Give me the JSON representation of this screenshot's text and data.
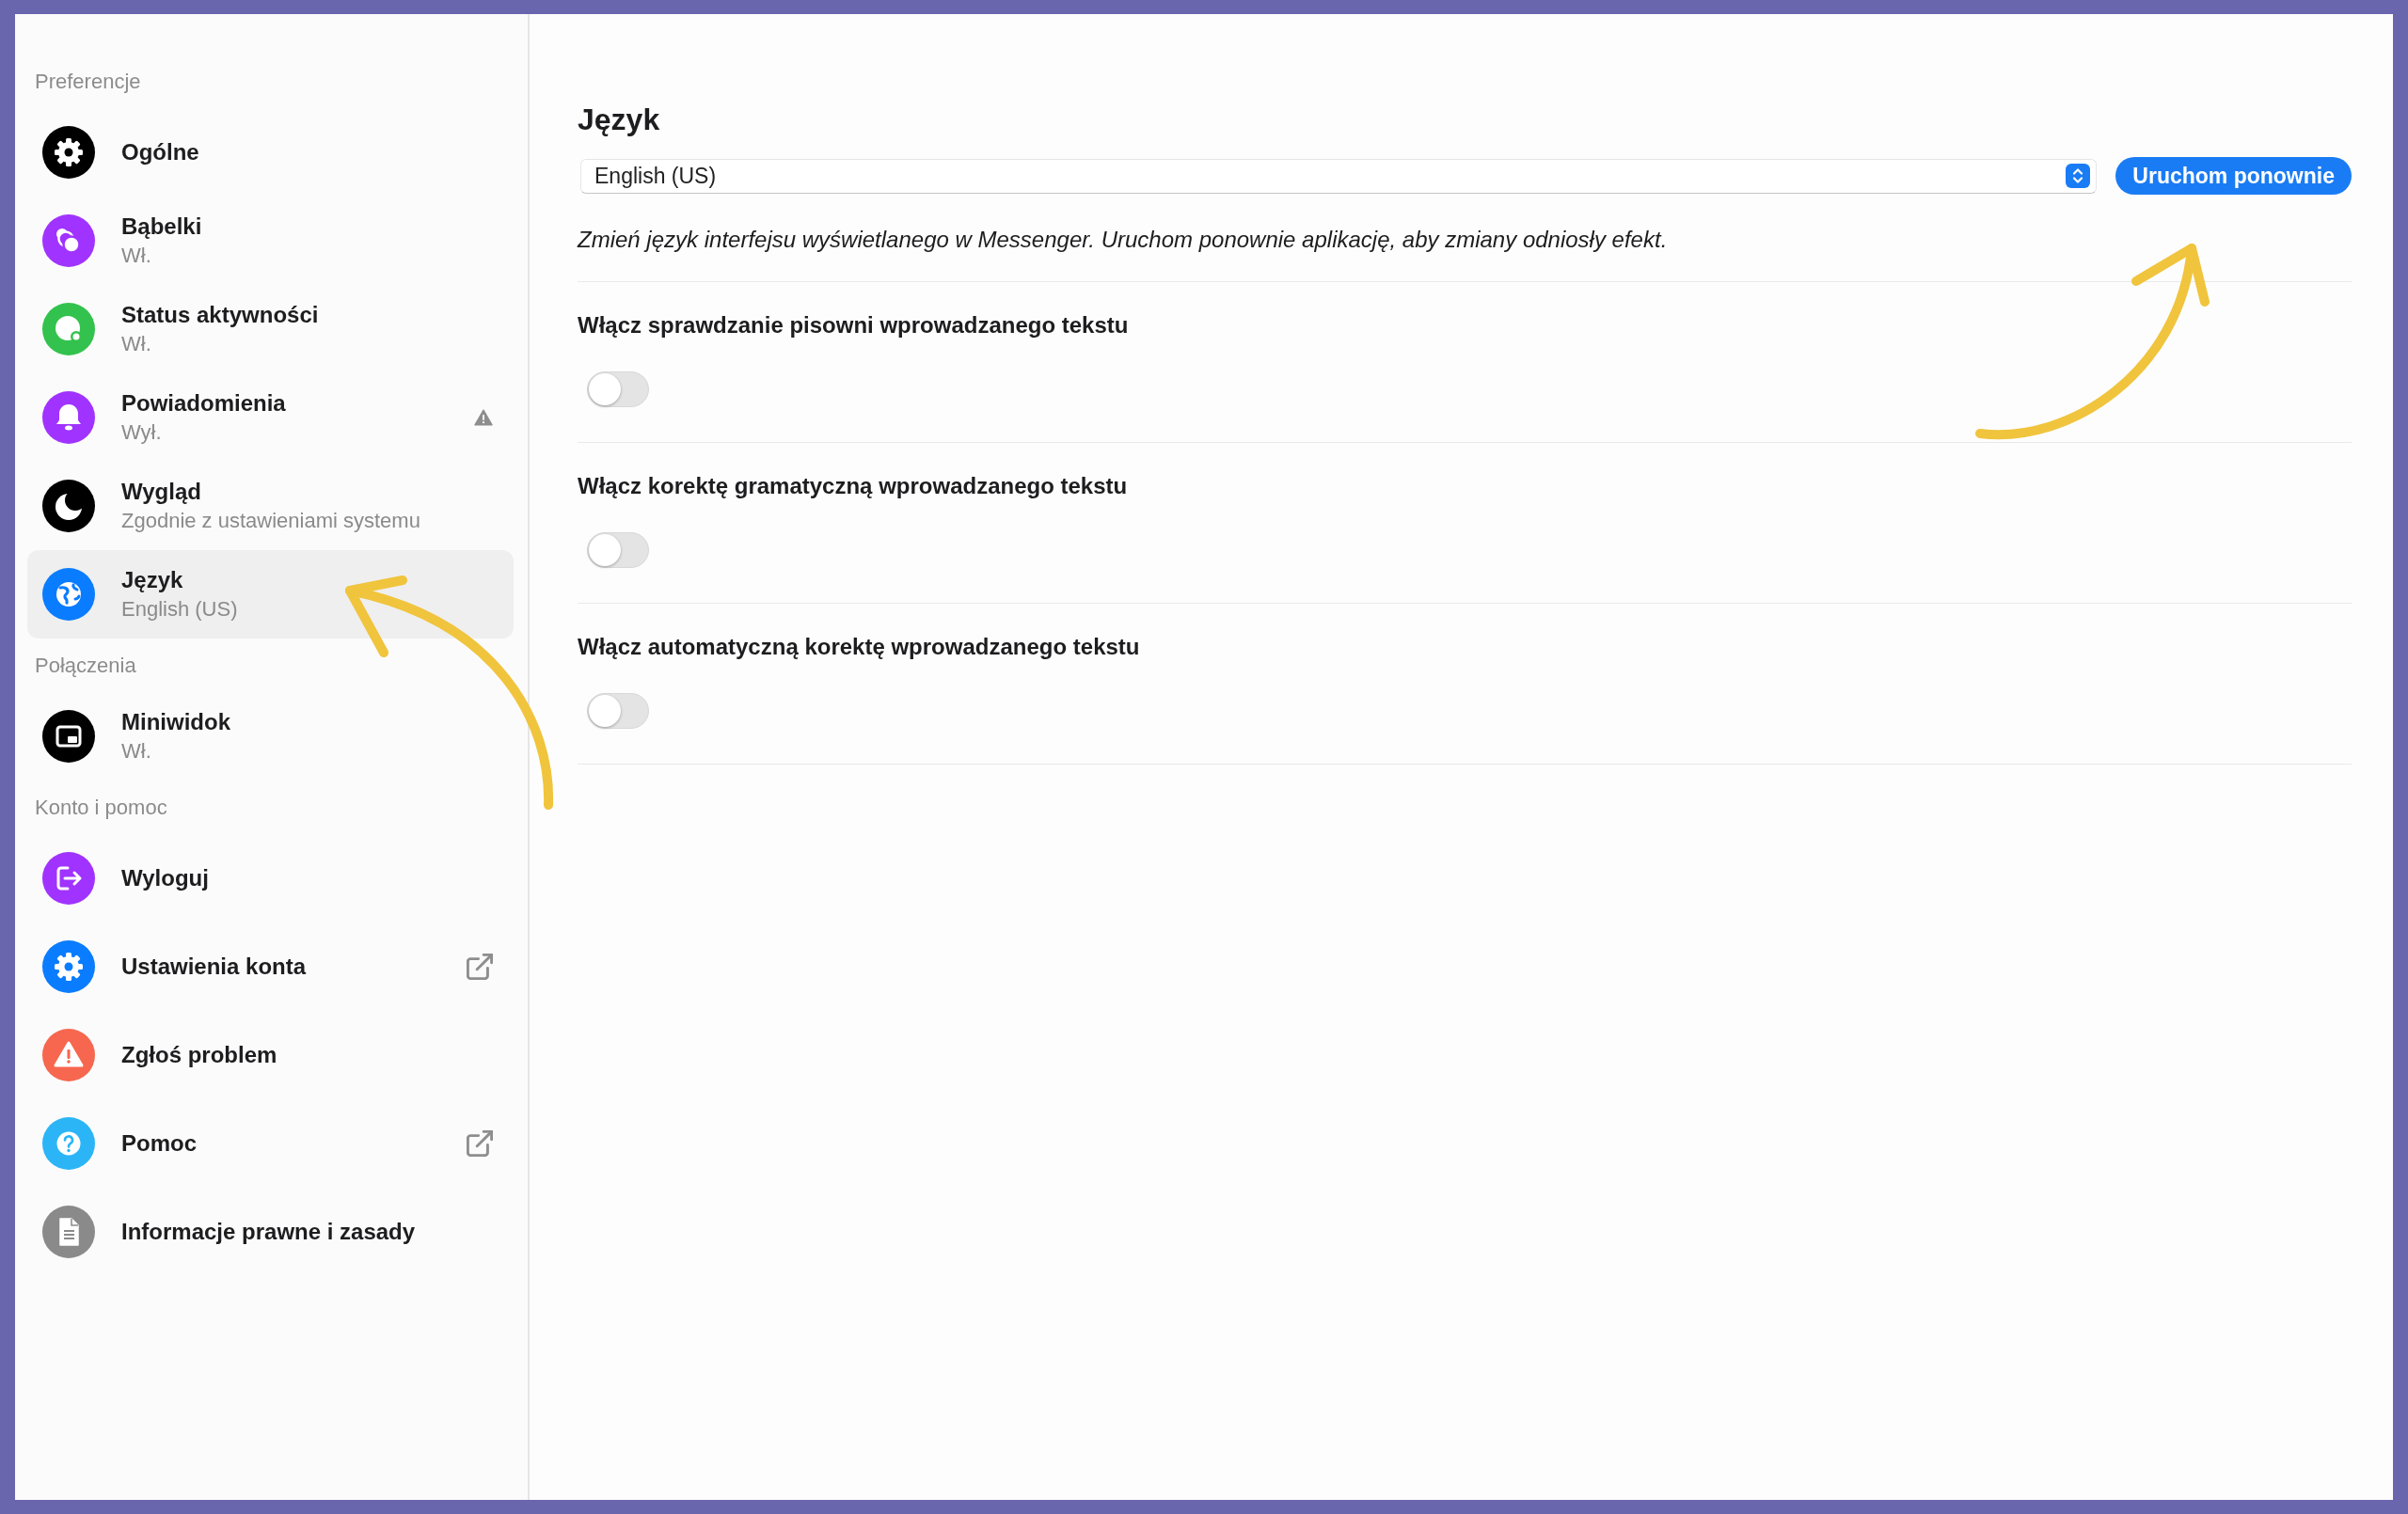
{
  "sidebar": {
    "sections": [
      {
        "title": "Preferencje",
        "items": [
          {
            "label": "Ogólne",
            "color": "#000000",
            "selected": false,
            "warning": false,
            "external": false
          },
          {
            "label": "Bąbelki",
            "subtitle": "Wł.",
            "color": "#a033ff",
            "selected": false,
            "warning": false,
            "external": false
          },
          {
            "label": "Status aktywności",
            "subtitle": "Wł.",
            "color": "#33c24d",
            "selected": false,
            "warning": false,
            "external": false
          },
          {
            "label": "Powiadomienia",
            "subtitle": "Wył.",
            "color": "#a033ff",
            "selected": false,
            "warning": true,
            "external": false
          },
          {
            "label": "Wygląd",
            "subtitle": "Zgodnie z ustawieniami systemu",
            "color": "#000000",
            "selected": false,
            "warning": false,
            "external": false
          },
          {
            "label": "Język",
            "subtitle": "English (US)",
            "color": "#0a7cff",
            "selected": true,
            "warning": false,
            "external": false
          }
        ]
      },
      {
        "title": "Połączenia",
        "items": [
          {
            "label": "Miniwidok",
            "subtitle": "Wł.",
            "color": "#000000",
            "selected": false,
            "warning": false,
            "external": false
          }
        ]
      },
      {
        "title": "Konto i pomoc",
        "items": [
          {
            "label": "Wyloguj",
            "color": "#a033ff",
            "selected": false,
            "warning": false,
            "external": false
          },
          {
            "label": "Ustawienia konta",
            "color": "#0a7cff",
            "selected": false,
            "warning": false,
            "external": true
          },
          {
            "label": "Zgłoś problem",
            "color": "#f7664e",
            "selected": false,
            "warning": false,
            "external": false
          },
          {
            "label": "Pomoc",
            "color": "#2bb5f7",
            "selected": false,
            "warning": false,
            "external": true
          },
          {
            "label": "Informacje prawne i zasady",
            "color": "#8a8a8a",
            "selected": false,
            "warning": false,
            "external": false
          }
        ]
      }
    ]
  },
  "language": {
    "title": "Język",
    "select": {
      "value": "English (US)"
    },
    "restart_button": "Uruchom ponownie",
    "description": "Zmień język interfejsu wyświetlanego w Messenger. Uruchom ponownie aplikację, aby zmiany odniosły efekt."
  },
  "toggles": [
    {
      "label": "Włącz sprawdzanie pisowni wprowadzanego tekstu",
      "on": false
    },
    {
      "label": "Włącz korektę gramatyczną wprowadzanego tekstu",
      "on": false
    },
    {
      "label": "Włącz automatyczną korektę wprowadzanego tekstu",
      "on": false
    }
  ]
}
